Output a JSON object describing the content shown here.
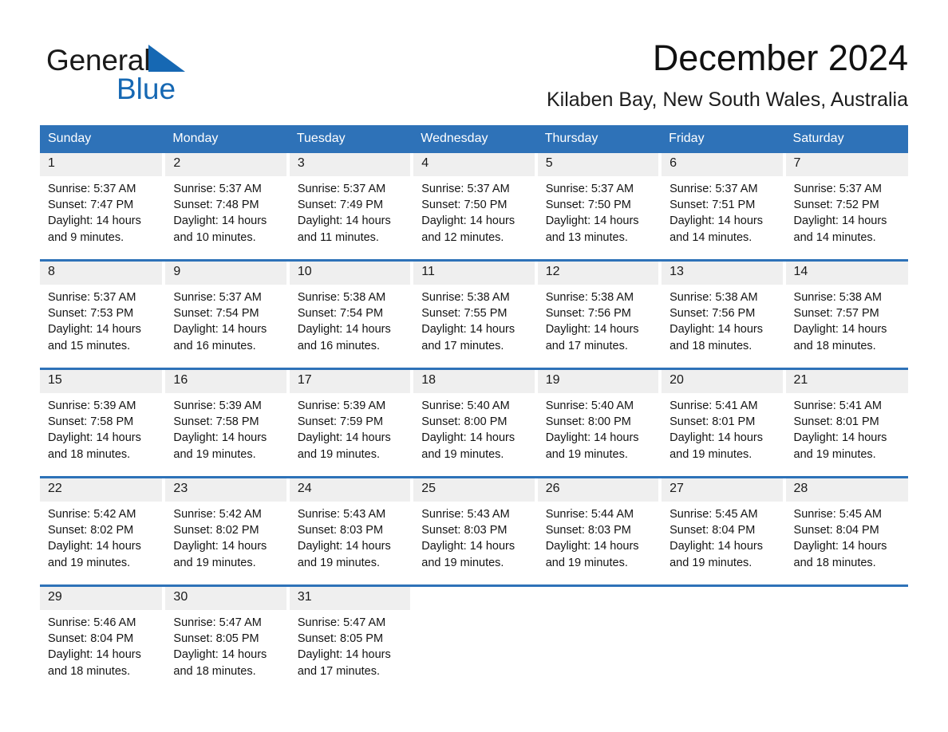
{
  "brand": {
    "name_part1": "General",
    "name_part2": "Blue",
    "triangle_color": "#1668b3"
  },
  "header": {
    "month_title": "December 2024",
    "location": "Kilaben Bay, New South Wales, Australia"
  },
  "theme": {
    "header_bg": "#2e72b8",
    "daynum_bg": "#efefef",
    "divider": "#2e72b8",
    "text": "#141414"
  },
  "calendar": {
    "weekday_headers": [
      "Sunday",
      "Monday",
      "Tuesday",
      "Wednesday",
      "Thursday",
      "Friday",
      "Saturday"
    ],
    "weeks": [
      {
        "days": [
          {
            "date": "1",
            "sunrise": "Sunrise: 5:37 AM",
            "sunset": "Sunset: 7:47 PM",
            "daylight_line1": "Daylight: 14 hours",
            "daylight_line2": "and 9 minutes."
          },
          {
            "date": "2",
            "sunrise": "Sunrise: 5:37 AM",
            "sunset": "Sunset: 7:48 PM",
            "daylight_line1": "Daylight: 14 hours",
            "daylight_line2": "and 10 minutes."
          },
          {
            "date": "3",
            "sunrise": "Sunrise: 5:37 AM",
            "sunset": "Sunset: 7:49 PM",
            "daylight_line1": "Daylight: 14 hours",
            "daylight_line2": "and 11 minutes."
          },
          {
            "date": "4",
            "sunrise": "Sunrise: 5:37 AM",
            "sunset": "Sunset: 7:50 PM",
            "daylight_line1": "Daylight: 14 hours",
            "daylight_line2": "and 12 minutes."
          },
          {
            "date": "5",
            "sunrise": "Sunrise: 5:37 AM",
            "sunset": "Sunset: 7:50 PM",
            "daylight_line1": "Daylight: 14 hours",
            "daylight_line2": "and 13 minutes."
          },
          {
            "date": "6",
            "sunrise": "Sunrise: 5:37 AM",
            "sunset": "Sunset: 7:51 PM",
            "daylight_line1": "Daylight: 14 hours",
            "daylight_line2": "and 14 minutes."
          },
          {
            "date": "7",
            "sunrise": "Sunrise: 5:37 AM",
            "sunset": "Sunset: 7:52 PM",
            "daylight_line1": "Daylight: 14 hours",
            "daylight_line2": "and 14 minutes."
          }
        ]
      },
      {
        "days": [
          {
            "date": "8",
            "sunrise": "Sunrise: 5:37 AM",
            "sunset": "Sunset: 7:53 PM",
            "daylight_line1": "Daylight: 14 hours",
            "daylight_line2": "and 15 minutes."
          },
          {
            "date": "9",
            "sunrise": "Sunrise: 5:37 AM",
            "sunset": "Sunset: 7:54 PM",
            "daylight_line1": "Daylight: 14 hours",
            "daylight_line2": "and 16 minutes."
          },
          {
            "date": "10",
            "sunrise": "Sunrise: 5:38 AM",
            "sunset": "Sunset: 7:54 PM",
            "daylight_line1": "Daylight: 14 hours",
            "daylight_line2": "and 16 minutes."
          },
          {
            "date": "11",
            "sunrise": "Sunrise: 5:38 AM",
            "sunset": "Sunset: 7:55 PM",
            "daylight_line1": "Daylight: 14 hours",
            "daylight_line2": "and 17 minutes."
          },
          {
            "date": "12",
            "sunrise": "Sunrise: 5:38 AM",
            "sunset": "Sunset: 7:56 PM",
            "daylight_line1": "Daylight: 14 hours",
            "daylight_line2": "and 17 minutes."
          },
          {
            "date": "13",
            "sunrise": "Sunrise: 5:38 AM",
            "sunset": "Sunset: 7:56 PM",
            "daylight_line1": "Daylight: 14 hours",
            "daylight_line2": "and 18 minutes."
          },
          {
            "date": "14",
            "sunrise": "Sunrise: 5:38 AM",
            "sunset": "Sunset: 7:57 PM",
            "daylight_line1": "Daylight: 14 hours",
            "daylight_line2": "and 18 minutes."
          }
        ]
      },
      {
        "days": [
          {
            "date": "15",
            "sunrise": "Sunrise: 5:39 AM",
            "sunset": "Sunset: 7:58 PM",
            "daylight_line1": "Daylight: 14 hours",
            "daylight_line2": "and 18 minutes."
          },
          {
            "date": "16",
            "sunrise": "Sunrise: 5:39 AM",
            "sunset": "Sunset: 7:58 PM",
            "daylight_line1": "Daylight: 14 hours",
            "daylight_line2": "and 19 minutes."
          },
          {
            "date": "17",
            "sunrise": "Sunrise: 5:39 AM",
            "sunset": "Sunset: 7:59 PM",
            "daylight_line1": "Daylight: 14 hours",
            "daylight_line2": "and 19 minutes."
          },
          {
            "date": "18",
            "sunrise": "Sunrise: 5:40 AM",
            "sunset": "Sunset: 8:00 PM",
            "daylight_line1": "Daylight: 14 hours",
            "daylight_line2": "and 19 minutes."
          },
          {
            "date": "19",
            "sunrise": "Sunrise: 5:40 AM",
            "sunset": "Sunset: 8:00 PM",
            "daylight_line1": "Daylight: 14 hours",
            "daylight_line2": "and 19 minutes."
          },
          {
            "date": "20",
            "sunrise": "Sunrise: 5:41 AM",
            "sunset": "Sunset: 8:01 PM",
            "daylight_line1": "Daylight: 14 hours",
            "daylight_line2": "and 19 minutes."
          },
          {
            "date": "21",
            "sunrise": "Sunrise: 5:41 AM",
            "sunset": "Sunset: 8:01 PM",
            "daylight_line1": "Daylight: 14 hours",
            "daylight_line2": "and 19 minutes."
          }
        ]
      },
      {
        "days": [
          {
            "date": "22",
            "sunrise": "Sunrise: 5:42 AM",
            "sunset": "Sunset: 8:02 PM",
            "daylight_line1": "Daylight: 14 hours",
            "daylight_line2": "and 19 minutes."
          },
          {
            "date": "23",
            "sunrise": "Sunrise: 5:42 AM",
            "sunset": "Sunset: 8:02 PM",
            "daylight_line1": "Daylight: 14 hours",
            "daylight_line2": "and 19 minutes."
          },
          {
            "date": "24",
            "sunrise": "Sunrise: 5:43 AM",
            "sunset": "Sunset: 8:03 PM",
            "daylight_line1": "Daylight: 14 hours",
            "daylight_line2": "and 19 minutes."
          },
          {
            "date": "25",
            "sunrise": "Sunrise: 5:43 AM",
            "sunset": "Sunset: 8:03 PM",
            "daylight_line1": "Daylight: 14 hours",
            "daylight_line2": "and 19 minutes."
          },
          {
            "date": "26",
            "sunrise": "Sunrise: 5:44 AM",
            "sunset": "Sunset: 8:03 PM",
            "daylight_line1": "Daylight: 14 hours",
            "daylight_line2": "and 19 minutes."
          },
          {
            "date": "27",
            "sunrise": "Sunrise: 5:45 AM",
            "sunset": "Sunset: 8:04 PM",
            "daylight_line1": "Daylight: 14 hours",
            "daylight_line2": "and 19 minutes."
          },
          {
            "date": "28",
            "sunrise": "Sunrise: 5:45 AM",
            "sunset": "Sunset: 8:04 PM",
            "daylight_line1": "Daylight: 14 hours",
            "daylight_line2": "and 18 minutes."
          }
        ]
      },
      {
        "days": [
          {
            "date": "29",
            "sunrise": "Sunrise: 5:46 AM",
            "sunset": "Sunset: 8:04 PM",
            "daylight_line1": "Daylight: 14 hours",
            "daylight_line2": "and 18 minutes."
          },
          {
            "date": "30",
            "sunrise": "Sunrise: 5:47 AM",
            "sunset": "Sunset: 8:05 PM",
            "daylight_line1": "Daylight: 14 hours",
            "daylight_line2": "and 18 minutes."
          },
          {
            "date": "31",
            "sunrise": "Sunrise: 5:47 AM",
            "sunset": "Sunset: 8:05 PM",
            "daylight_line1": "Daylight: 14 hours",
            "daylight_line2": "and 17 minutes."
          },
          {
            "date": "",
            "sunrise": "",
            "sunset": "",
            "daylight_line1": "",
            "daylight_line2": ""
          },
          {
            "date": "",
            "sunrise": "",
            "sunset": "",
            "daylight_line1": "",
            "daylight_line2": ""
          },
          {
            "date": "",
            "sunrise": "",
            "sunset": "",
            "daylight_line1": "",
            "daylight_line2": ""
          },
          {
            "date": "",
            "sunrise": "",
            "sunset": "",
            "daylight_line1": "",
            "daylight_line2": ""
          }
        ]
      }
    ]
  }
}
